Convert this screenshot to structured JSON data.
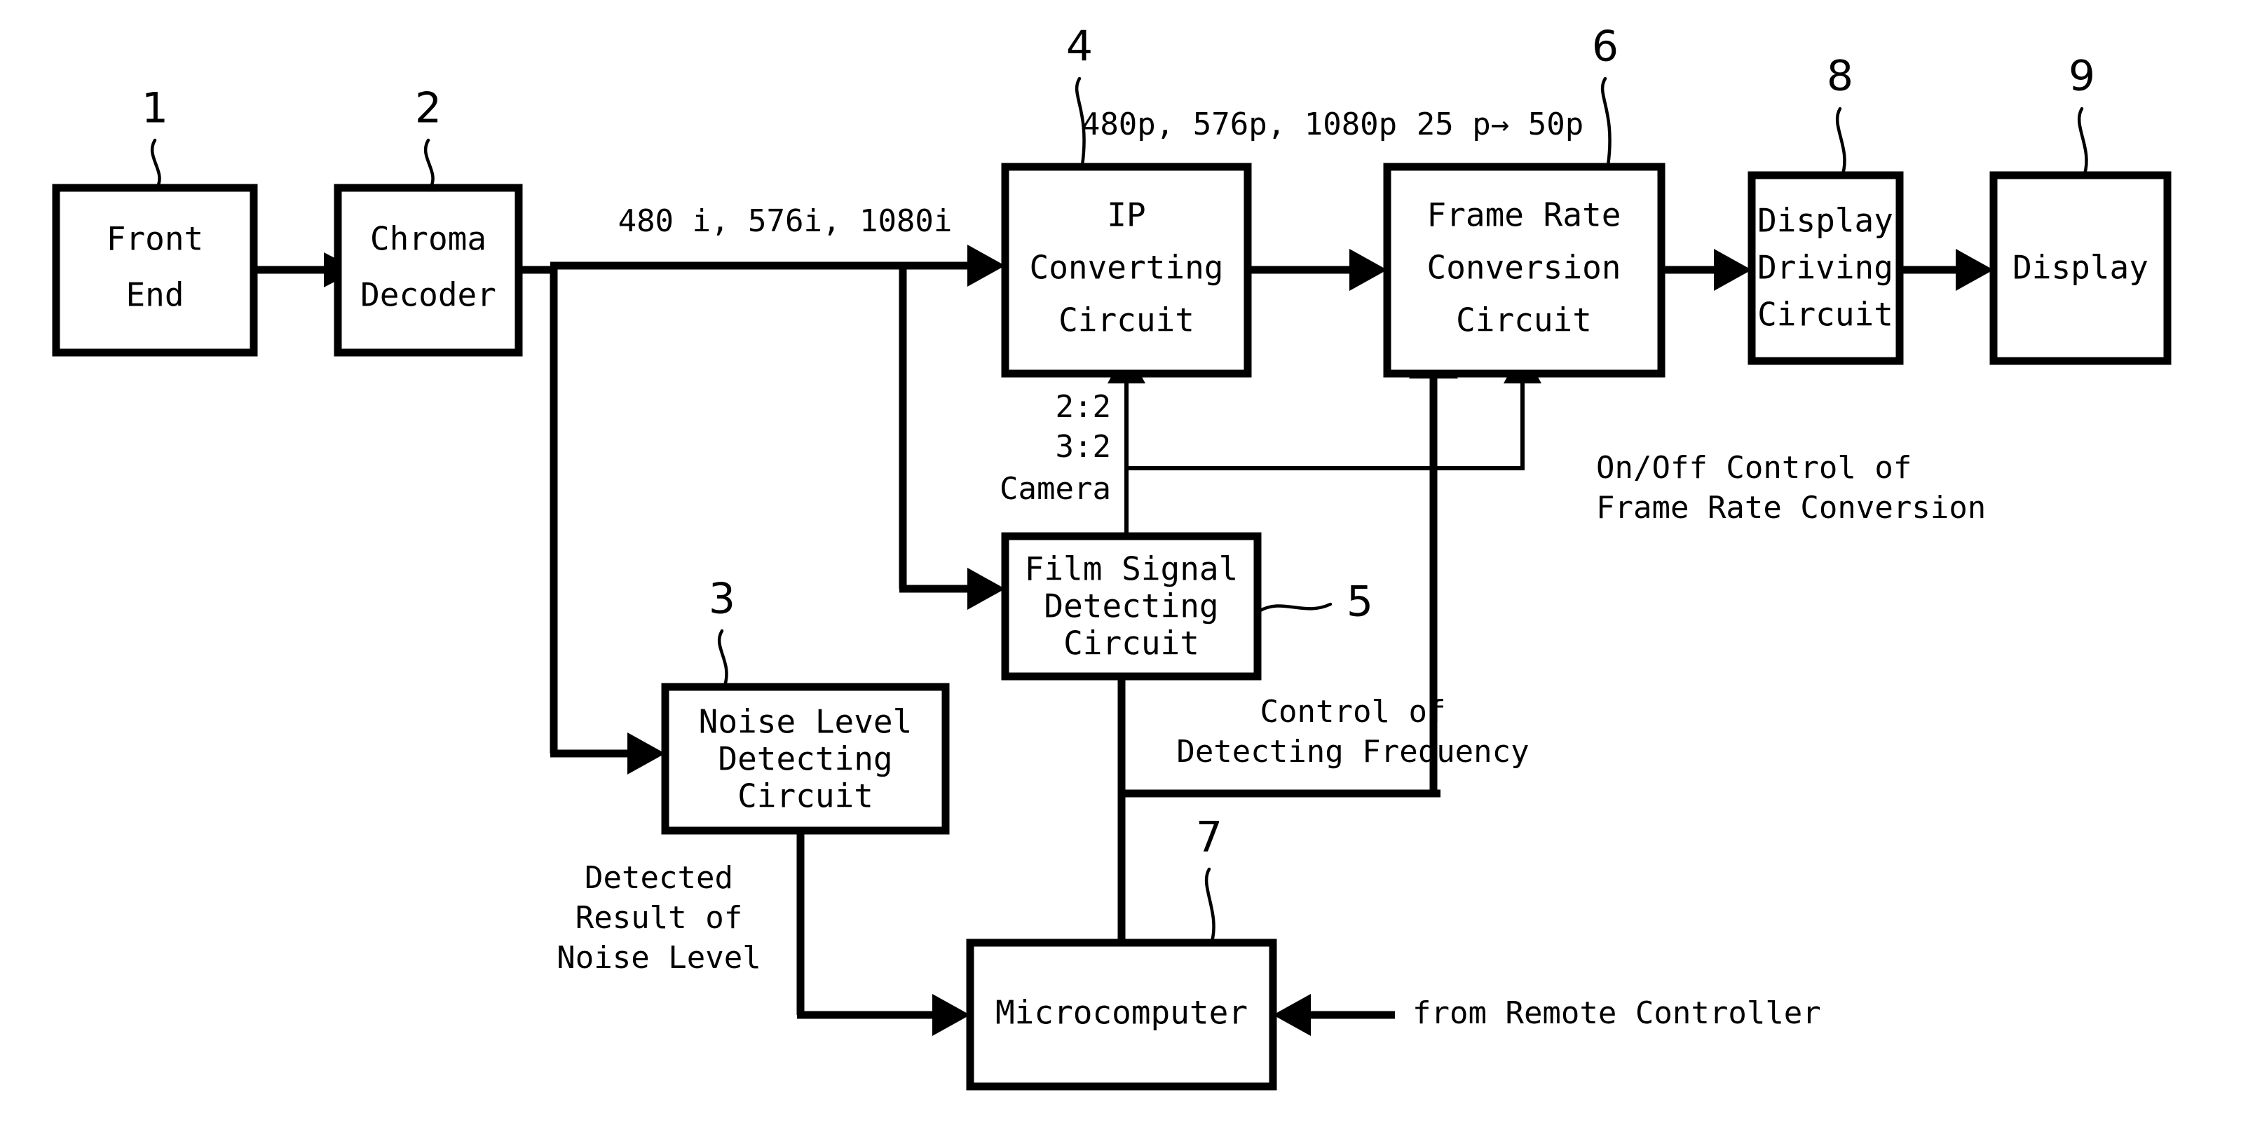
{
  "figure": {
    "type": "block-diagram",
    "title": "Video signal processing block diagram",
    "background_color": "#ffffff",
    "line_color": "#000000"
  },
  "blocks": [
    {
      "ref": "1",
      "lines": [
        "Front",
        "End"
      ],
      "name": "front-end"
    },
    {
      "ref": "2",
      "lines": [
        "Chroma",
        "Decoder"
      ],
      "name": "chroma-decoder"
    },
    {
      "ref": "3",
      "lines": [
        "Noise Level",
        "Detecting",
        "Circuit"
      ],
      "name": "noise-level-detecting-circuit"
    },
    {
      "ref": "4",
      "lines": [
        "IP",
        "Converting",
        "Circuit"
      ],
      "name": "ip-converting-circuit"
    },
    {
      "ref": "5",
      "lines": [
        "Film Signal",
        "Detecting",
        "Circuit"
      ],
      "name": "film-signal-detecting-circuit"
    },
    {
      "ref": "6",
      "lines": [
        "Frame Rate",
        "Conversion",
        "Circuit"
      ],
      "name": "frame-rate-conversion-circuit"
    },
    {
      "ref": "7",
      "lines": [
        "Microcomputer"
      ],
      "name": "microcomputer"
    },
    {
      "ref": "8",
      "lines": [
        "Display",
        "Driving",
        "Circuit"
      ],
      "name": "display-driving-circuit"
    },
    {
      "ref": "9",
      "lines": [
        "Display"
      ],
      "name": "display"
    }
  ],
  "reference_numerals": {
    "n1": "1",
    "n2": "2",
    "n3": "3",
    "n4": "4",
    "n5": "5",
    "n6": "6",
    "n7": "7",
    "n8": "8",
    "n9": "9"
  },
  "block_labels": {
    "front_end_l1": "Front",
    "front_end_l2": "End",
    "chroma_l1": "Chroma",
    "chroma_l2": "Decoder",
    "noise_l1": "Noise Level",
    "noise_l2": "Detecting",
    "noise_l3": "Circuit",
    "ip_l1": "IP",
    "ip_l2": "Converting",
    "ip_l3": "Circuit",
    "film_l1": "Film Signal",
    "film_l2": "Detecting",
    "film_l3": "Circuit",
    "frc_l1": "Frame Rate",
    "frc_l2": "Conversion",
    "frc_l3": "Circuit",
    "micro_l1": "Microcomputer",
    "ddc_l1": "Display",
    "ddc_l2": "Driving",
    "ddc_l3": "Circuit",
    "display_l1": "Display"
  },
  "signal_labels": {
    "interlaced_formats": "480 i, 576i, 1080i",
    "progressive_formats": "480p, 576p, 1080p",
    "frame_rate_conversion": "25 p→ 50p",
    "cadence_22": "2:2",
    "cadence_32": "3:2",
    "cadence_camera": "Camera",
    "onoff_l1": "On/Off Control of",
    "onoff_l2": "Frame Rate Conversion",
    "control_freq_l1": "Control of",
    "control_freq_l2": "Detecting Frequency",
    "detected_noise_l1": "Detected",
    "detected_noise_l2": "Result of",
    "detected_noise_l3": "Noise Level",
    "remote": "from Remote Controller"
  },
  "connections": [
    {
      "from": "front-end",
      "to": "chroma-decoder",
      "name": "wire-front-end-to-chroma"
    },
    {
      "from": "chroma-decoder",
      "to": "ip-converting-circuit",
      "label": "480 i, 576i, 1080i",
      "name": "wire-chroma-to-ip"
    },
    {
      "from": "chroma-decoder",
      "to": "noise-level-detecting-circuit",
      "name": "wire-chroma-to-noise"
    },
    {
      "from": "chroma-decoder",
      "to": "film-signal-detecting-circuit",
      "name": "wire-chroma-to-film"
    },
    {
      "from": "ip-converting-circuit",
      "to": "frame-rate-conversion-circuit",
      "label": "480p, 576p, 1080p",
      "name": "wire-ip-to-frc"
    },
    {
      "from": "frame-rate-conversion-circuit",
      "to": "display-driving-circuit",
      "name": "wire-frc-to-ddc"
    },
    {
      "from": "display-driving-circuit",
      "to": "display",
      "name": "wire-ddc-to-display"
    },
    {
      "from": "film-signal-detecting-circuit",
      "to": "ip-converting-circuit",
      "label": "2:2 3:2 Camera",
      "name": "wire-film-to-ip"
    },
    {
      "from": "film-signal-detecting-circuit",
      "to": "frame-rate-conversion-circuit",
      "name": "wire-film-to-frc"
    },
    {
      "from": "film-signal-detecting-circuit",
      "to": "microcomputer",
      "name": "wire-film-to-micro"
    },
    {
      "from": "noise-level-detecting-circuit",
      "to": "microcomputer",
      "label": "Detected Result of Noise Level",
      "name": "wire-noise-to-micro"
    },
    {
      "from": "microcomputer",
      "to": "frame-rate-conversion-circuit",
      "label": "On/Off Control of Frame Rate Conversion",
      "name": "wire-micro-to-frc"
    },
    {
      "from": "remote-controller",
      "to": "microcomputer",
      "label": "from Remote Controller",
      "name": "wire-remote-to-micro"
    }
  ]
}
